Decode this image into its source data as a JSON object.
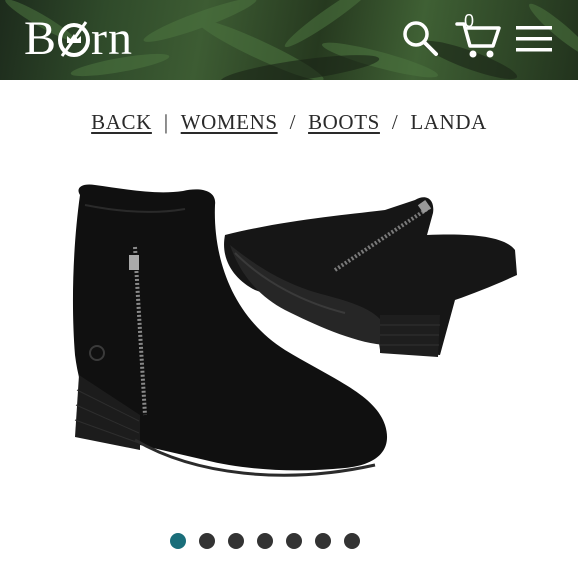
{
  "brand": {
    "name": "Born"
  },
  "header": {
    "cart_count": "0",
    "icons": [
      "search-icon",
      "cart-icon",
      "menu-icon"
    ]
  },
  "breadcrumb": [
    {
      "label": "BACK",
      "link": true
    },
    {
      "separator": "|"
    },
    {
      "label": "WOMENS",
      "link": true
    },
    {
      "separator": "/"
    },
    {
      "label": "BOOTS",
      "link": true
    },
    {
      "separator": "/"
    },
    {
      "label": "LANDA",
      "link": false
    }
  ],
  "carousel": {
    "total": 7,
    "active_index": 0,
    "colors": {
      "active": "#1a6e7a",
      "inactive": "#333333"
    }
  }
}
